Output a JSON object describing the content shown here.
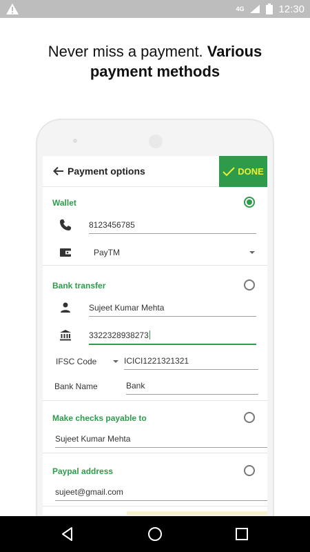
{
  "status_bar": {
    "time": "12:30",
    "signal": "4G"
  },
  "headline": {
    "regular": "Never miss a payment.",
    "bold_inline": "Various",
    "bold_line2": "payment methods"
  },
  "app_bar": {
    "title": "Payment options",
    "done_label": "DONE"
  },
  "wallet": {
    "title": "Wallet",
    "selected": true,
    "phone_value": "8123456785",
    "provider_value": "PayTM"
  },
  "bank_transfer": {
    "title": "Bank transfer",
    "selected": false,
    "name_value": "Sujeet Kumar Mehta",
    "account_value": "3322328938273",
    "ifsc_label": "IFSC Code",
    "ifsc_value": "ICICI1221321321",
    "bank_name_label": "Bank Name",
    "bank_name_value": "Bank"
  },
  "checks": {
    "title": "Make checks payable to",
    "selected": false,
    "value": "Sujeet Kumar Mehta"
  },
  "paypal": {
    "title": "Paypal address",
    "selected": false,
    "value": "sujeet@gmail.com"
  },
  "colors": {
    "accent": "#2e9b4b",
    "done_text": "#e6f23a",
    "status_bar": "#bdbdbd"
  },
  "icons": [
    "warning-icon",
    "signal-icon",
    "battery-icon",
    "back-arrow-icon",
    "check-icon",
    "phone-icon",
    "wallet-icon",
    "person-icon",
    "bank-icon",
    "back-nav-icon",
    "home-nav-icon",
    "recents-nav-icon"
  ]
}
